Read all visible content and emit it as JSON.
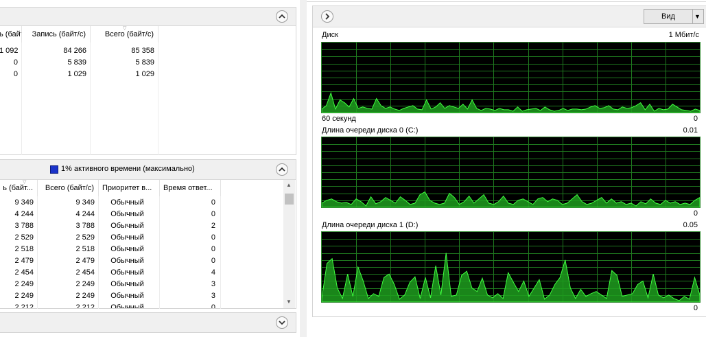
{
  "top_panel": {
    "columns": [
      "ь (байт/с)",
      "Запись (байт/с)",
      "Всего (байт/с)"
    ],
    "rows": [
      [
        "1 092",
        "84 266",
        "85 358"
      ],
      [
        "0",
        "5 839",
        "5 839"
      ],
      [
        "0",
        "1 029",
        "1 029"
      ]
    ]
  },
  "middle_panel": {
    "header_text": "1% активного времени (максимально)",
    "indicator_color": "#1a33c9",
    "columns": [
      "ь (байт...",
      "Всего (байт/с)",
      "Приоритет в...",
      "Время ответ..."
    ],
    "rows": [
      [
        "9 349",
        "9 349",
        "Обычный",
        "0"
      ],
      [
        "4 244",
        "4 244",
        "Обычный",
        "0"
      ],
      [
        "3 788",
        "3 788",
        "Обычный",
        "2"
      ],
      [
        "2 529",
        "2 529",
        "Обычный",
        "0"
      ],
      [
        "2 518",
        "2 518",
        "Обычный",
        "0"
      ],
      [
        "2 479",
        "2 479",
        "Обычный",
        "0"
      ],
      [
        "2 454",
        "2 454",
        "Обычный",
        "4"
      ],
      [
        "2 249",
        "2 249",
        "Обычный",
        "3"
      ],
      [
        "2 249",
        "2 249",
        "Обычный",
        "3"
      ],
      [
        "2 212",
        "2 212",
        "Обычный",
        "0"
      ]
    ]
  },
  "right_panel": {
    "view_button": "Вид",
    "graphs": [
      {
        "title": "Диск",
        "max_label": "1 Мбит/с",
        "bottom_left": "60 секунд",
        "bottom_right": "0",
        "values": [
          0.05,
          0.1,
          0.28,
          0.05,
          0.18,
          0.14,
          0.08,
          0.2,
          0.06,
          0.08,
          0.06,
          0.05,
          0.2,
          0.1,
          0.06,
          0.08,
          0.05,
          0.03,
          0.06,
          0.08,
          0.1,
          0.05,
          0.04,
          0.18,
          0.05,
          0.08,
          0.14,
          0.06,
          0.1,
          0.08,
          0.06,
          0.12,
          0.05,
          0.18,
          0.06,
          0.03,
          0.06,
          0.05,
          0.03,
          0.06,
          0.04,
          0.04,
          0.02,
          0.08,
          0.02,
          0.04,
          0.05,
          0.06,
          0.03,
          0.08,
          0.04,
          0.02,
          0.03,
          0.06,
          0.03,
          0.05,
          0.05,
          0.04,
          0.05,
          0.08,
          0.1,
          0.06,
          0.07,
          0.1,
          0.05,
          0.04,
          0.08,
          0.06,
          0.07,
          0.1,
          0.14,
          0.04,
          0.12,
          0.02,
          0.06,
          0.04,
          0.05,
          0.12,
          0.08,
          0.04,
          0.03,
          0.02,
          0.05,
          0.03
        ]
      },
      {
        "title": "Длина очереди диска 0 (C:)",
        "max_label": "0.01",
        "bottom_left": "",
        "bottom_right": "0",
        "values": [
          0.06,
          0.1,
          0.12,
          0.08,
          0.06,
          0.07,
          0.04,
          0.12,
          0.08,
          0.02,
          0.15,
          0.05,
          0.08,
          0.14,
          0.1,
          0.06,
          0.15,
          0.1,
          0.04,
          0.06,
          0.18,
          0.22,
          0.1,
          0.06,
          0.04,
          0.06,
          0.2,
          0.14,
          0.04,
          0.08,
          0.16,
          0.06,
          0.12,
          0.18,
          0.06,
          0.04,
          0.08,
          0.16,
          0.06,
          0.04,
          0.1,
          0.12,
          0.08,
          0.04,
          0.12,
          0.14,
          0.08,
          0.12,
          0.1,
          0.04,
          0.06,
          0.12,
          0.18,
          0.08,
          0.04,
          0.06,
          0.1,
          0.14,
          0.06,
          0.12,
          0.06,
          0.08,
          0.04,
          0.06,
          0.02,
          0.08,
          0.05,
          0.12,
          0.06,
          0.04,
          0.1,
          0.06,
          0.08,
          0.04,
          0.06,
          0.04,
          0.1,
          0.14
        ]
      },
      {
        "title": "Длина очереди диска 1 (D:)",
        "max_label": "0.05",
        "bottom_left": "",
        "bottom_right": "0",
        "values": [
          0.05,
          0.55,
          0.62,
          0.2,
          0.05,
          0.4,
          0.08,
          0.5,
          0.3,
          0.05,
          0.12,
          0.08,
          0.35,
          0.4,
          0.25,
          0.04,
          0.1,
          0.28,
          0.36,
          0.05,
          0.35,
          0.06,
          0.52,
          0.1,
          0.7,
          0.08,
          0.1,
          0.38,
          0.44,
          0.2,
          0.15,
          0.34,
          0.1,
          0.06,
          0.12,
          0.05,
          0.42,
          0.28,
          0.15,
          0.3,
          0.08,
          0.2,
          0.32,
          0.04,
          0.1,
          0.25,
          0.35,
          0.6,
          0.2,
          0.05,
          0.18,
          0.08,
          0.12,
          0.15,
          0.1,
          0.05,
          0.45,
          0.38,
          0.08,
          0.1,
          0.12,
          0.25,
          0.3,
          0.06,
          0.4,
          0.1,
          0.06,
          0.1,
          0.05,
          0.02,
          0.08,
          0.04,
          0.35,
          0.1
        ]
      }
    ]
  }
}
